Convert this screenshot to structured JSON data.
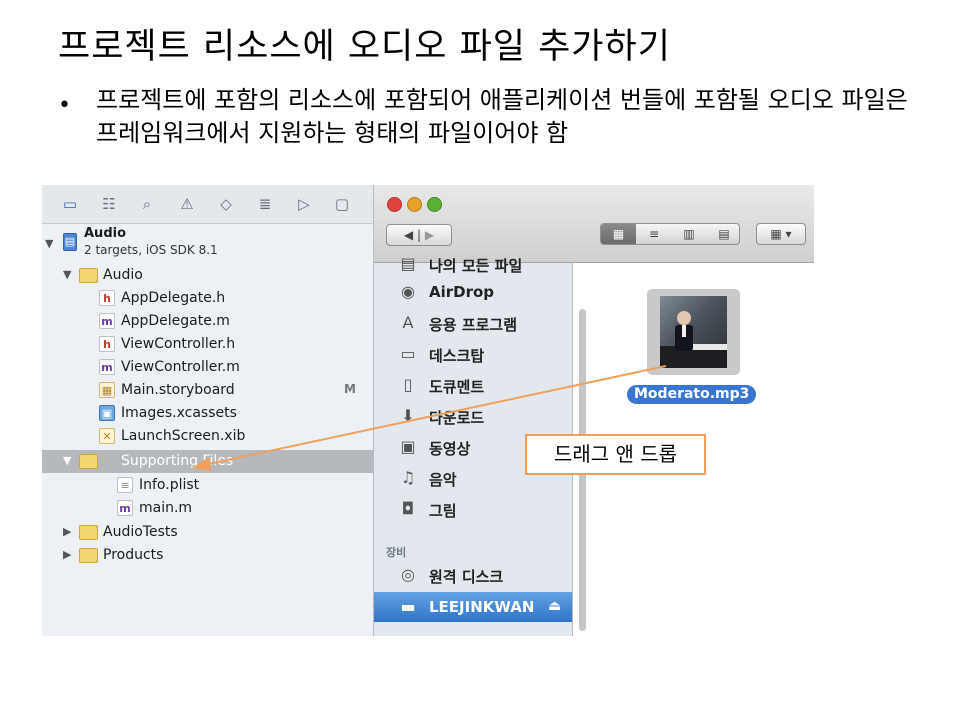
{
  "slide": {
    "title": "프로젝트 리소스에 오디오 파일 추가하기",
    "bullet": "프로젝트에 포함의 리소스에 포함되어 애플리케이션 번들에 포함될 오디오 파일은 프레임워크에서 지원하는 형태의 파일이어야 함",
    "callout": "드래그 앤 드롭"
  },
  "navigator": {
    "toolbar_icons": [
      "folder-icon",
      "hierarchy-icon",
      "search-icon",
      "warning-icon",
      "test-diamond-icon",
      "list-icon",
      "breakpoint-icon",
      "log-icon"
    ],
    "project": {
      "name": "Audio",
      "subtitle": "2 targets, iOS SDK 8.1"
    },
    "items": [
      {
        "label": "Audio",
        "kind": "folder"
      },
      {
        "label": "AppDelegate.h",
        "kind": "h"
      },
      {
        "label": "AppDelegate.m",
        "kind": "m"
      },
      {
        "label": "ViewController.h",
        "kind": "h"
      },
      {
        "label": "ViewController.m",
        "kind": "m"
      },
      {
        "label": "Main.storyboard",
        "kind": "storyboard",
        "badge": "M"
      },
      {
        "label": "Images.xcassets",
        "kind": "xcassets"
      },
      {
        "label": "LaunchScreen.xib",
        "kind": "xib"
      },
      {
        "label": "Supporting Files",
        "kind": "folder"
      },
      {
        "label": "Info.plist",
        "kind": "plist"
      },
      {
        "label": "main.m",
        "kind": "m"
      },
      {
        "label": "AudioTests",
        "kind": "folder"
      },
      {
        "label": "Products",
        "kind": "folder"
      }
    ]
  },
  "finder": {
    "sidebar": {
      "partial_item": "나의 모든 파일",
      "items": [
        {
          "label": "AirDrop",
          "icon": "airdrop-icon"
        },
        {
          "label": "응용 프로그램",
          "icon": "applications-icon"
        },
        {
          "label": "데스크탑",
          "icon": "desktop-icon"
        },
        {
          "label": "도큐멘트",
          "icon": "documents-icon"
        },
        {
          "label": "다운로드",
          "icon": "downloads-icon"
        },
        {
          "label": "동영상",
          "icon": "movies-icon"
        },
        {
          "label": "음악",
          "icon": "music-icon"
        },
        {
          "label": "그림",
          "icon": "pictures-icon"
        }
      ],
      "devices_heading": "장비",
      "devices": [
        {
          "label": "원격 디스크",
          "icon": "disc-icon"
        },
        {
          "label": "LEEJINKWAN",
          "icon": "drive-icon"
        }
      ]
    },
    "file": {
      "name": "Moderato.mp3"
    }
  }
}
